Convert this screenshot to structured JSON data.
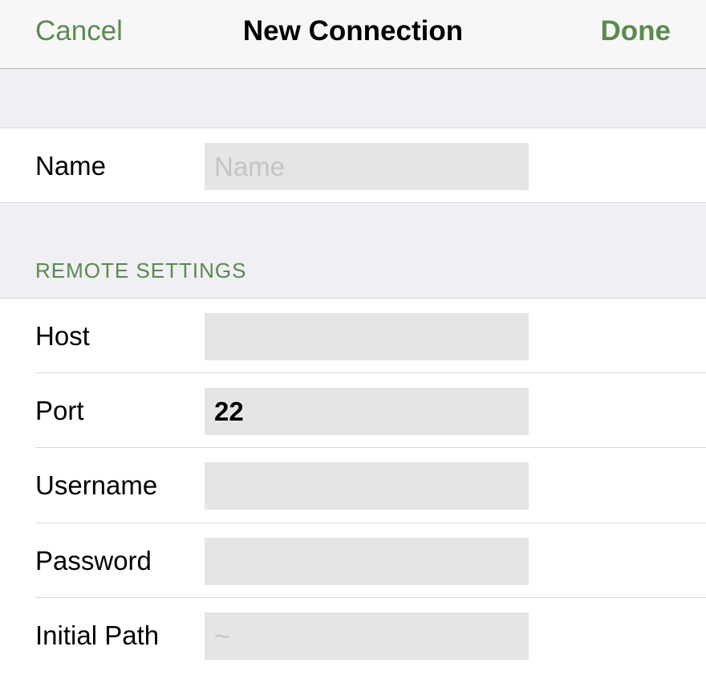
{
  "navbar": {
    "cancel_label": "Cancel",
    "title": "New Connection",
    "done_label": "Done"
  },
  "name_group": {
    "label": "Name",
    "placeholder": "Name",
    "value": ""
  },
  "remote_settings": {
    "header": "REMOTE SETTINGS",
    "host": {
      "label": "Host",
      "value": "",
      "placeholder": ""
    },
    "port": {
      "label": "Port",
      "value": "22"
    },
    "username": {
      "label": "Username",
      "value": ""
    },
    "password": {
      "label": "Password",
      "value": ""
    },
    "initial_path": {
      "label": "Initial Path",
      "placeholder": "~",
      "value": ""
    }
  },
  "colors": {
    "accent": "#5b8a4e",
    "background": "#efeff4",
    "field": "#e5e5e5"
  }
}
